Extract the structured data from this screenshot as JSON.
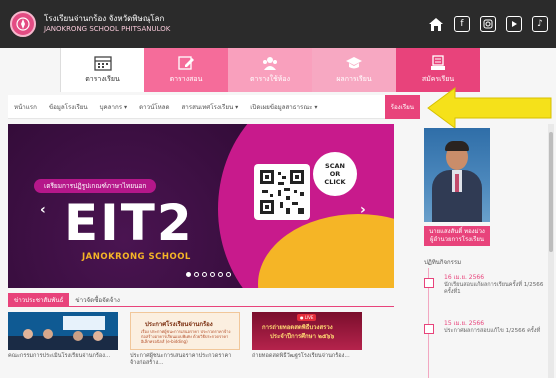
{
  "header": {
    "school_th": "โรงเรียนจ่านกร้อง จังหวัดพิษณุโลก",
    "school_en": "JANOKRONG SCHOOL PHITSANULOK",
    "icons": [
      "home-icon",
      "facebook-icon",
      "instagram-icon",
      "youtube-icon",
      "tiktok-icon"
    ]
  },
  "tiles": [
    {
      "label": "ตารางเรียน",
      "icon": "calendar-icon"
    },
    {
      "label": "ตารางสอน",
      "icon": "edit-icon"
    },
    {
      "label": "ตารางใช้ห้อง",
      "icon": "group-icon"
    },
    {
      "label": "ผลการเรียน",
      "icon": "graduation-icon"
    },
    {
      "label": "สมัครเรียน",
      "icon": "register-icon"
    }
  ],
  "menu": [
    {
      "label": "หน้าแรก"
    },
    {
      "label": "ข้อมูลโรงเรียน"
    },
    {
      "label": "บุคลากร ▾"
    },
    {
      "label": "ดาวน์โหลด"
    },
    {
      "label": "สารสนเทศโรงเรียน ▾"
    },
    {
      "label": "เปิดเผยข้อมูลสาธารณะ ▾"
    },
    {
      "label": "ร้องเรียน"
    }
  ],
  "banner": {
    "pill": "เตรียมการปฏิรูปเกณฑ์ภาษาไทยนอก",
    "headline": "EIT2",
    "school_name": "JANOKRONG SCHOOL",
    "scan_1": "SCAN",
    "scan_2": "OR",
    "scan_3": "CLICK",
    "prev": "‹",
    "next": "›"
  },
  "news_tabs": [
    {
      "label": "ข่าวประชาสัมพันธ์"
    },
    {
      "label": "ข่าวจัดซื้อจัดจ้าง"
    }
  ],
  "news": [
    {
      "caption": "คณะกรรมการประเมินโรงเรียนจ่านกร้อง..."
    },
    {
      "caption": "ประกาศผู้ชนะการเสนอราคาประกวดราคาจ้างก่อสร้าง...",
      "t1": "ประกาศโรงเรียนจ่านกร้อง",
      "t2": "เรื่อง ประกาศผู้ชนะการเสนอราคา ประกวดราคาจ้างก่อสร้างอาคารเรียนแบบพิเศษ ด้วยวิธีประกวดราคาอิเล็กทรอนิกส์ (e-bidding)"
    },
    {
      "caption": "ถ่ายทอดสดพิธีวัฒฐรโรงเรียนจ่านกร้อง...",
      "live": "● LIVE",
      "t1": "การถ่ายทอดสดพิธีบวงสรวง",
      "t2": "ประจำปีการศึกษา ๒๕๖๖"
    }
  ],
  "director": {
    "name": "นายแสงสันติ์ ทองม่วง",
    "title": "ผู้อำนวยการโรงเรียน"
  },
  "calendar": {
    "heading": "ปฏิทินกิจกรรม",
    "events": [
      {
        "date": "16 เม.ย. 2566",
        "text": "นักเรียนสอบแก้ผลการเรียนครั้งที่ 1/2566 ครั้งที่1"
      },
      {
        "date": "15 เม.ย. 2566",
        "text": "ประกาศผลการสอบแก้ไข 1/2566 ครั้งที่"
      }
    ]
  },
  "colors": {
    "accent": "#e8437b",
    "dark": "#2b2b2b",
    "yellow": "#f5e11a"
  }
}
